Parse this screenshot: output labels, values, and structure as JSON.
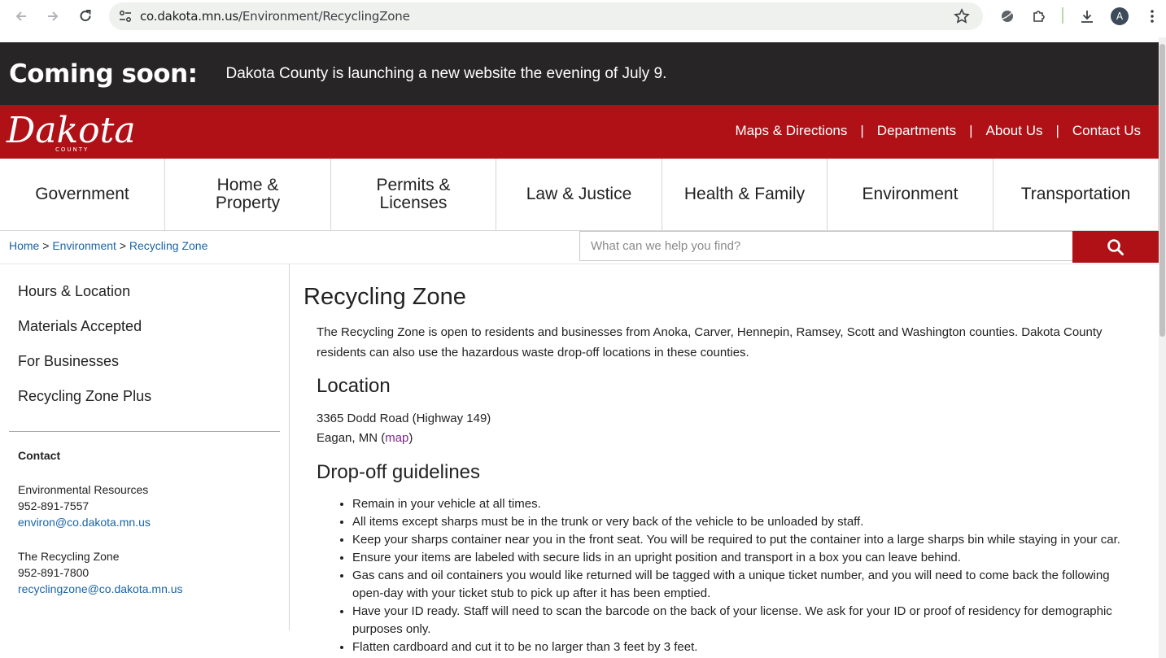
{
  "browser": {
    "url_host": "co.dakota.mn.us",
    "url_path": "/Environment/RecyclingZone",
    "avatar_letter": "A"
  },
  "banner": {
    "title": "Coming soon:",
    "message": "Dakota County is launching a new website the evening of July 9."
  },
  "header": {
    "logo_text": "Dakota",
    "logo_sub": "COUNTY",
    "util_links": [
      "Maps & Directions",
      "Departments",
      "About Us",
      "Contact Us"
    ],
    "separator": "|"
  },
  "mainnav": {
    "items": [
      "Government",
      "Home & Property",
      "Permits & Licenses",
      "Law & Justice",
      "Health & Family",
      "Environment",
      "Transportation"
    ]
  },
  "breadcrumb": {
    "items": [
      "Home",
      "Environment",
      "Recycling Zone"
    ],
    "separator": ">"
  },
  "search": {
    "placeholder": "What can we help you find?"
  },
  "sidebar": {
    "links": [
      "Hours & Location",
      "Materials Accepted",
      "For Businesses",
      "Recycling Zone Plus"
    ],
    "contact": {
      "heading": "Contact",
      "org1": "Environmental Resources",
      "phone1": "952-891-7557",
      "email1": "environ@co.dakota.mn.us",
      "org2": "The Recycling Zone",
      "phone2": "952-891-7800",
      "email2": "recyclingzone@co.dakota.mn.us"
    }
  },
  "content": {
    "title": "Recycling Zone",
    "intro": "The Recycling Zone is open to residents and businesses from Anoka, Carver, Hennepin, Ramsey, Scott and Washington counties. Dakota County residents can also use the hazardous waste drop-off locations in these counties.",
    "location_heading": "Location",
    "address_line1": "3365 Dodd Road (Highway 149)",
    "address_line2": "Eagan, MN (",
    "map_link": "map",
    "address_close": ")",
    "dropoff_heading": "Drop-off guidelines",
    "guidelines": [
      "Remain in your vehicle at all times.",
      "All items except sharps must be in the trunk or very back of the vehicle to be unloaded by staff.",
      "Keep your sharps container near you in the front seat.  You will be required to put the container into a large sharps bin while staying in your car.",
      "Ensure your items are labeled with secure lids in an upright position and transport in a box you can leave behind.",
      "Gas cans and oil containers you would like returned will be tagged with a unique ticket number, and you will need to come back the following open-day with your ticket stub to pick up after it has been emptied.",
      "Have your ID ready. Staff will need to scan the barcode on the back of your license. We ask for your ID or proof of residency for demographic purposes only.",
      "Flatten cardboard and cut it to be no larger than 3 feet by 3 feet."
    ]
  },
  "colors": {
    "brand_red": "#b01116",
    "banner_dark": "#282526",
    "link_blue": "#1a63a4",
    "visited_purple": "#7b2a8f"
  }
}
